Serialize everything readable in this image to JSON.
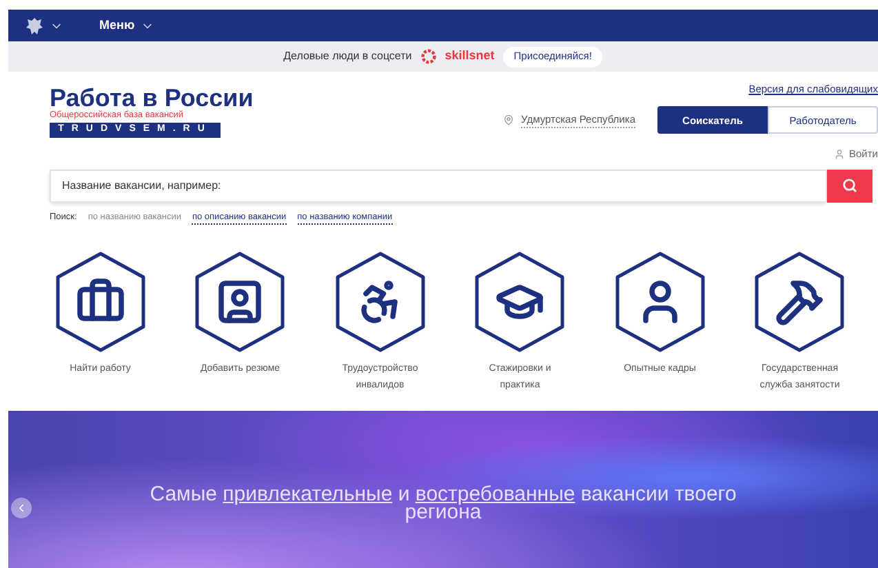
{
  "topbar": {
    "menu": "Меню"
  },
  "promo": {
    "text": "Деловые люди в соцсети",
    "brand": "skillsnet",
    "button": "Присоединяйся!"
  },
  "header": {
    "logo_title": "Работа в России",
    "logo_subtitle": "Общероссийская база вакансий",
    "logo_domain": "TRUDVSEM.RU",
    "accessibility_link": "Версия для слабовидящих",
    "region": "Удмуртская Республика",
    "roles": [
      {
        "label": "Соискатель",
        "selected": true
      },
      {
        "label": "Работодатель",
        "selected": false
      }
    ],
    "login": "Войти"
  },
  "search": {
    "placeholder": "Название вакансии, например:",
    "label": "Поиск:",
    "modes": [
      {
        "label": "по названию вакансии",
        "selected": true
      },
      {
        "label": "по описанию вакансии",
        "selected": false
      },
      {
        "label": "по названию компании",
        "selected": false
      }
    ]
  },
  "tiles": [
    {
      "kind": "briefcase",
      "label": "Найти работу"
    },
    {
      "kind": "resume",
      "label": "Добавить резюме"
    },
    {
      "kind": "wheelchair",
      "label": "Трудоустройство инвалидов"
    },
    {
      "kind": "graduation",
      "label": "Стажировки и практика"
    },
    {
      "kind": "person",
      "label": "Опытные кадры"
    },
    {
      "kind": "hammers",
      "label": "Государственная служба занятости"
    }
  ],
  "banner": {
    "headline": [
      {
        "kind": "text",
        "text": "Самые"
      },
      {
        "kind": "link",
        "text": "привлекательные"
      },
      {
        "kind": "text",
        "text": "и"
      },
      {
        "kind": "link",
        "text": "востребованные"
      },
      {
        "kind": "text",
        "text": "вакансии твоего региона"
      }
    ]
  }
}
